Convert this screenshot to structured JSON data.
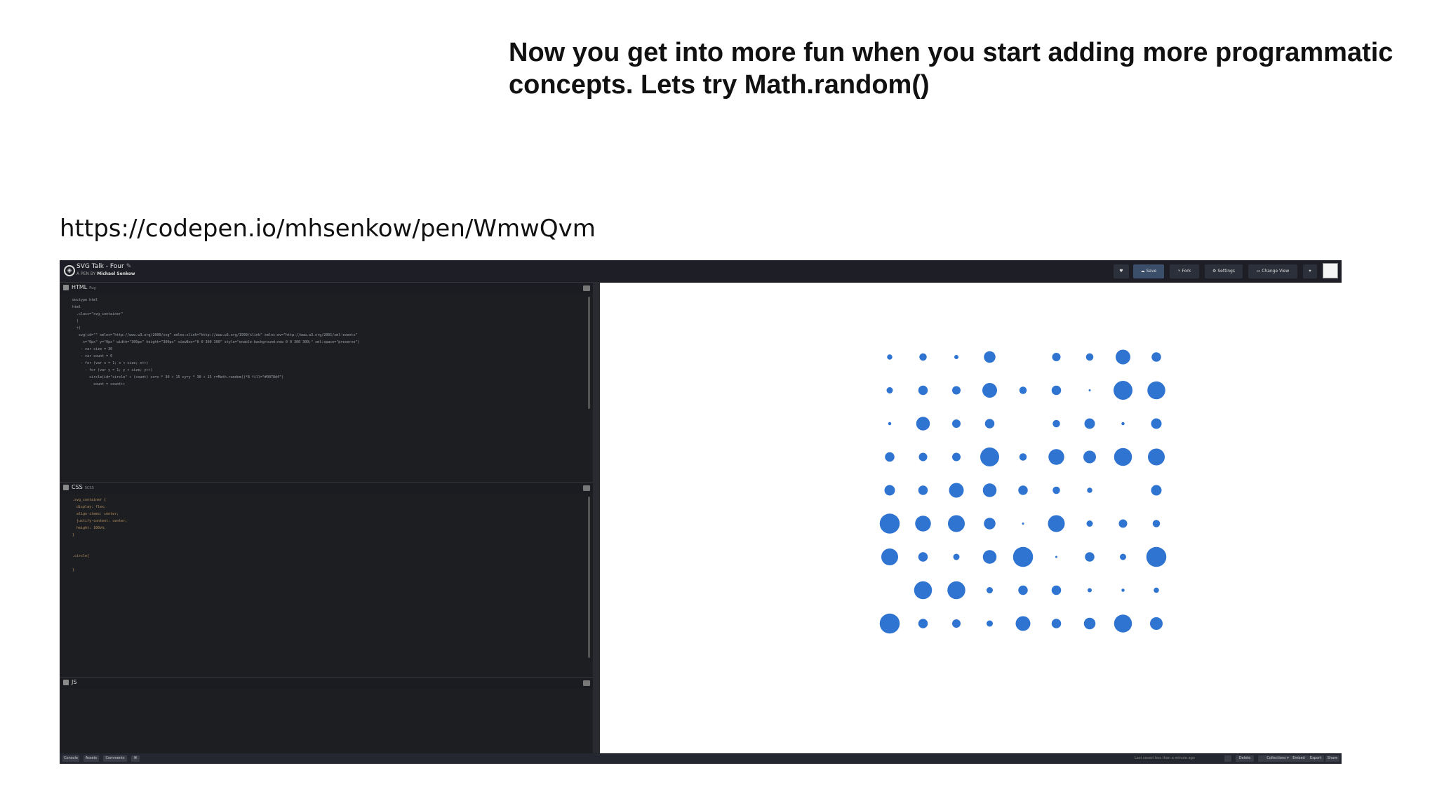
{
  "slide": {
    "title": "Now you get into more fun when you start adding more programmatic concepts. Lets try Math.random()",
    "url": "https://codepen.io/mhsenkow/pen/WmwQvm"
  },
  "codepen": {
    "pen_title": "SVG Talk - Four",
    "pen_author_prefix": "A PEN BY",
    "pen_author": "Michael Senkow",
    "toolbar": {
      "heart_label": "♥",
      "save_label": "Save",
      "fork_label": "Fork",
      "settings_label": "Settings",
      "change_view_label": "Change View",
      "pin_label": "📌"
    },
    "panels": {
      "html": {
        "name": "HTML",
        "lang": "Pug",
        "code": "doctype html\nhtml\n  .class=\"svg_container\"\n  )\n  +(\n   svg(id=\"\" xmlns=\"http://www.w3.org/2000/svg\" xmlns:xlink=\"http://www.w3.org/1999/xlink\" xmlns:ev=\"http://www.w3.org/2001/xml-events\"\n     x=\"0px\" y=\"0px\" width=\"300px\" height=\"300px\" viewBox=\"0 0 300 300\" style=\"enable-background:new 0 0 300 300;\" xml:space=\"preserve\")\n    - var size = 30\n    - var count = 0\n    - for (var x = 1; x < size; x++)\n      - for (var y = 1; y < size; y++)\n        circle(id=\"circle\" + (count) cx=x * 30 + 15 cy=y * 30 + 15 r=Math.random()*8 fill=\"#0078d4\")\n          count = count++"
      },
      "css": {
        "name": "CSS",
        "lang": "SCSS",
        "code": ".svg_container {\n  display: flex;\n  align-items: center;\n  justify-content: center;\n  height: 100vh;\n}\n\n\n.circle{\n\n}"
      },
      "js": {
        "name": "JS",
        "lang": ""
      }
    },
    "bottom_bar": {
      "console": "Console",
      "assets": "Assets",
      "comments": "Comments",
      "shortcut": "⌘",
      "last_saved": "Last saved less than a minute ago",
      "delete": "Delete",
      "collections": "Collections",
      "embed": "Embed",
      "export": "Export",
      "share": "Share"
    },
    "preview": {
      "dot_color": "#2f74d0",
      "grid_cols": 9,
      "grid_rows": 9,
      "dot_radii": [
        [
          0.25,
          0.35,
          0.2,
          0.55,
          0.0,
          0.4,
          0.35,
          0.7,
          0.45
        ],
        [
          0.3,
          0.45,
          0.4,
          0.7,
          0.35,
          0.45,
          0.1,
          0.9,
          0.85
        ],
        [
          0.15,
          0.65,
          0.4,
          0.45,
          0.0,
          0.35,
          0.5,
          0.15,
          0.5
        ],
        [
          0.45,
          0.4,
          0.4,
          0.9,
          0.35,
          0.75,
          0.6,
          0.85,
          0.8
        ],
        [
          0.5,
          0.45,
          0.7,
          0.65,
          0.45,
          0.35,
          0.25,
          0.0,
          0.5
        ],
        [
          0.95,
          0.75,
          0.8,
          0.55,
          0.1,
          0.8,
          0.3,
          0.4,
          0.35
        ],
        [
          0.8,
          0.45,
          0.3,
          0.65,
          0.95,
          0.1,
          0.45,
          0.3,
          0.95
        ],
        [
          0.0,
          0.85,
          0.85,
          0.3,
          0.45,
          0.45,
          0.2,
          0.15,
          0.25
        ],
        [
          0.95,
          0.45,
          0.4,
          0.3,
          0.7,
          0.45,
          0.55,
          0.85,
          0.6
        ]
      ]
    }
  }
}
